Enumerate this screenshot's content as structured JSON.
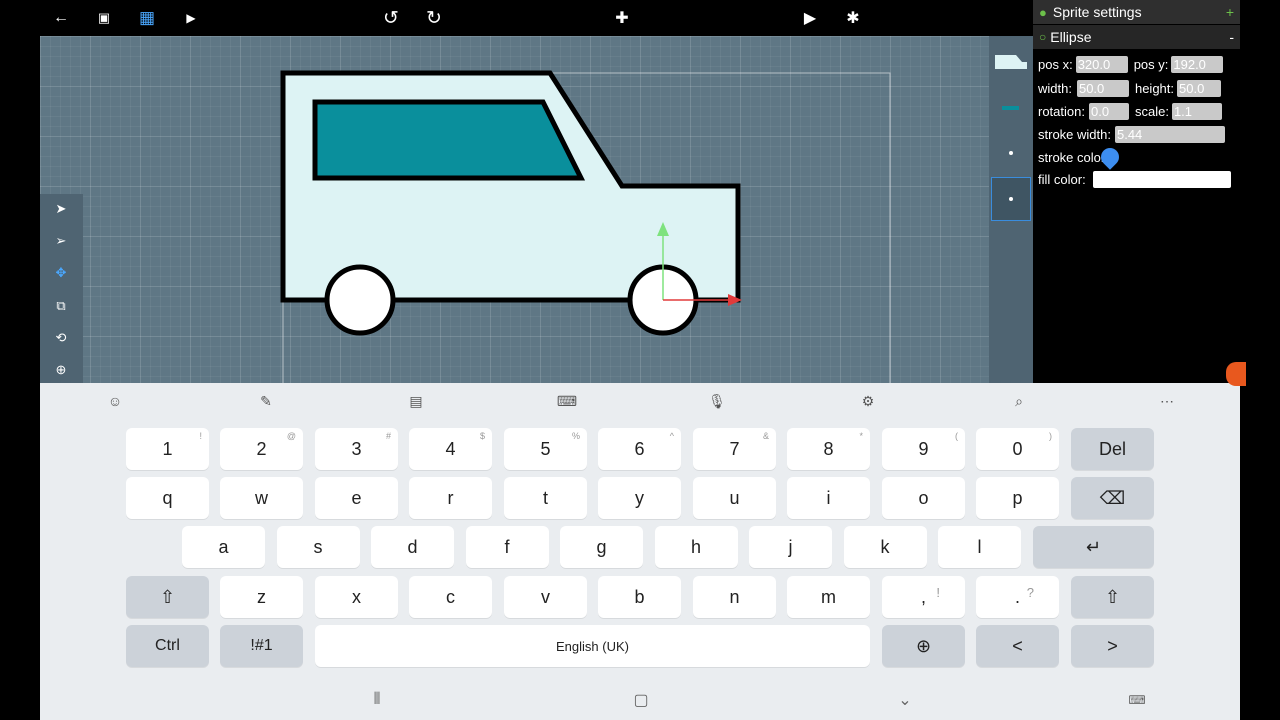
{
  "toolbar": {
    "back_icon": "←",
    "save_icon": "▣",
    "grid_icon": "▦",
    "video_icon": "▶",
    "undo_icon": "↺",
    "redo_icon": "↻",
    "add_sprite_icon": "✚",
    "play_icon": "▶",
    "debug_icon": "✱"
  },
  "left_tools": [
    "select",
    "direct-select",
    "move",
    "resize",
    "rotate",
    "add-point"
  ],
  "panel": {
    "title": "Sprite settings",
    "title_action": "+",
    "sprite_name": "Ellipse",
    "sprite_action": "-",
    "pos_x_label": "pos x:",
    "pos_x": "320.0",
    "pos_y_label": "pos y:",
    "pos_y": "192.0",
    "width_label": "width:",
    "width": "50.0",
    "height_label": "height:",
    "height": "50.0",
    "rotation_label": "rotation:",
    "rotation": "0.0",
    "scale_label": "scale:",
    "scale": "1.1",
    "stroke_width_label": "stroke width:",
    "stroke_width": "5.44",
    "stroke_color_label": "stroke color:",
    "stroke_color": "#000000",
    "fill_color_label": "fill color:",
    "fill_color": "#ffffff"
  },
  "keyboard": {
    "number_row": [
      {
        "key": "1",
        "hint": "!"
      },
      {
        "key": "2",
        "hint": "@"
      },
      {
        "key": "3",
        "hint": "#"
      },
      {
        "key": "4",
        "hint": "$"
      },
      {
        "key": "5",
        "hint": "%"
      },
      {
        "key": "6",
        "hint": "^"
      },
      {
        "key": "7",
        "hint": "&"
      },
      {
        "key": "8",
        "hint": "*"
      },
      {
        "key": "9",
        "hint": "("
      },
      {
        "key": "0",
        "hint": ")"
      }
    ],
    "del_label": "Del",
    "row_q": [
      "q",
      "w",
      "e",
      "r",
      "t",
      "y",
      "u",
      "i",
      "o",
      "p"
    ],
    "row_a": [
      "a",
      "s",
      "d",
      "f",
      "g",
      "h",
      "j",
      "k",
      "l"
    ],
    "row_z": [
      "z",
      "x",
      "c",
      "v",
      "b",
      "n",
      "m"
    ],
    "comma": ",",
    "comma_hint": "!",
    "period": ".",
    "period_hint": "?",
    "ctrl_label": "Ctrl",
    "symbols_label": "!#1",
    "space_label": "English (UK)",
    "backspace_icon": "⌫",
    "enter_icon": "↵",
    "shift_icon": "⇧",
    "globe_icon": "⊕",
    "left_icon": "<",
    "right_icon": ">"
  },
  "colors": {
    "canvas": "#5f7785",
    "car_body": "#ddf3f4",
    "car_window": "#0a8f9c",
    "accent": "#3a8dde",
    "keyboard_bg": "#eaedf0"
  }
}
